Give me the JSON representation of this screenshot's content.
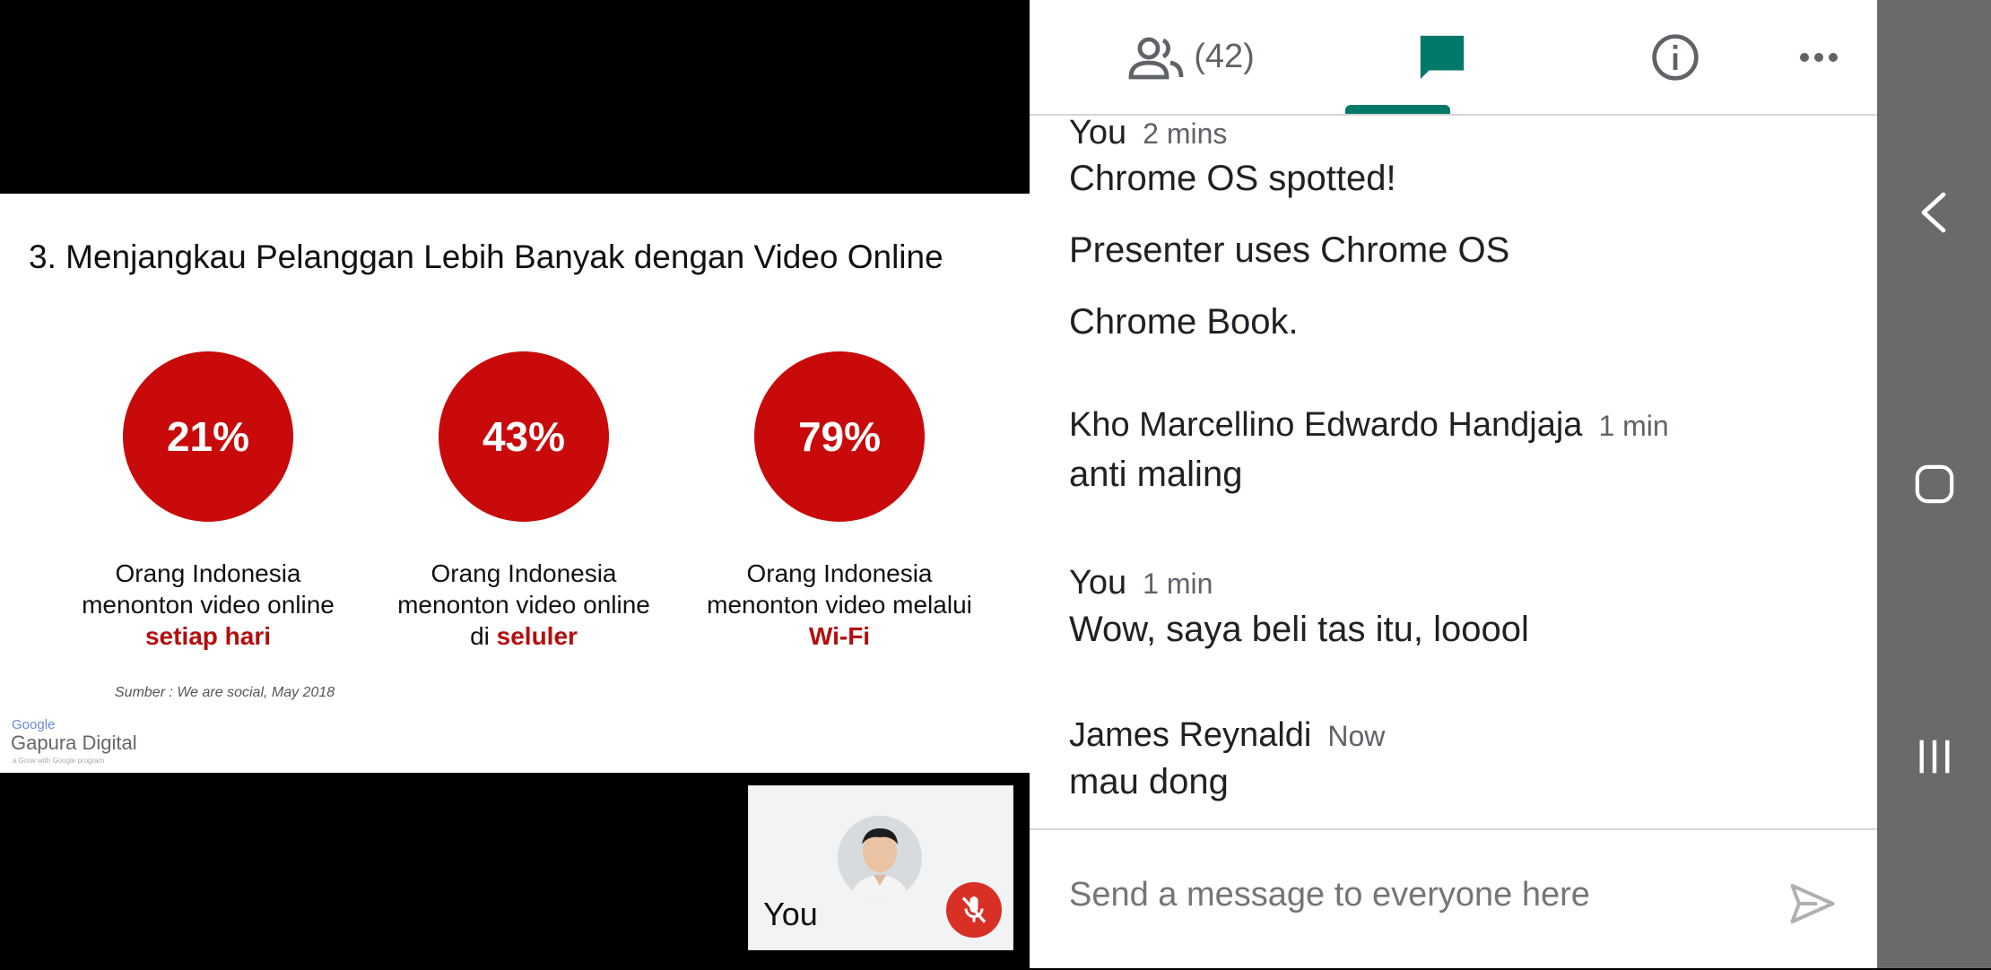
{
  "slide": {
    "title": "3. Menjangkau Pelanggan Lebih Banyak dengan Video Online",
    "stats": [
      {
        "value": "21%",
        "line1": "Orang Indonesia",
        "line2": "menonton video online",
        "line3_prefix": "",
        "line3_highlight": "setiap hari"
      },
      {
        "value": "43%",
        "line1": "Orang Indonesia",
        "line2": "menonton video online",
        "line3_prefix": "di ",
        "line3_highlight": "seluler"
      },
      {
        "value": "79%",
        "line1": "Orang Indonesia",
        "line2": "menonton video melalui",
        "line3_prefix": "",
        "line3_highlight": "Wi-Fi"
      }
    ],
    "source": "Sumber : We are social, May 2018",
    "logo_google": "Google",
    "logo_name": "Gapura Digital",
    "logo_tag": "a Grow with Google program",
    "accent_color": "#c80a0a"
  },
  "self_view": {
    "label": "You",
    "mic_icon": "mic-off-icon"
  },
  "tabs": {
    "people_count": "(42)",
    "people_icon": "people-icon",
    "chat_icon": "chat-icon",
    "info_icon": "info-icon",
    "more_icon": "more-horiz-icon",
    "active_color": "#00796b"
  },
  "chat": {
    "messages": [
      {
        "sender": "You",
        "time": "2 mins",
        "lines": [
          "Chrome OS spotted!",
          "Presenter uses Chrome OS",
          "Chrome Book."
        ]
      },
      {
        "sender": "Kho Marcellino Edwardo Handjaja",
        "time": "1 min",
        "lines": [
          "anti maling"
        ]
      },
      {
        "sender": "You",
        "time": "1 min",
        "lines": [
          "Wow, saya beli tas itu, looool"
        ]
      },
      {
        "sender": "James Reynaldi",
        "time": "Now",
        "lines": [
          "mau dong"
        ]
      }
    ],
    "composer_placeholder": "Send a message to everyone here"
  },
  "navbar": {
    "back_icon": "back-icon",
    "home_icon": "home-icon",
    "recents_icon": "recents-icon"
  }
}
